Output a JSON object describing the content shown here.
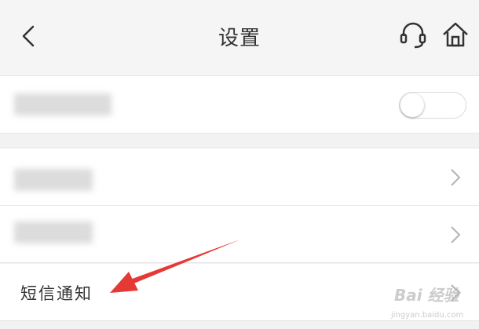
{
  "header": {
    "title": "设置",
    "back_icon": "chevron-left-icon",
    "customer_service_icon": "headset-icon",
    "home_icon": "home-icon"
  },
  "rows": [
    {
      "type": "toggle",
      "label_visible": false,
      "toggle_on": false
    },
    {
      "type": "link",
      "label_visible": false
    },
    {
      "type": "link",
      "label_visible": false
    },
    {
      "type": "link",
      "label": "短信通知"
    }
  ],
  "annotation": {
    "arrow_color": "#e53935"
  },
  "watermark": {
    "text": "Bai 经验",
    "sub": "jingyan.baidu.com"
  },
  "colors": {
    "background": "#f2f2f2",
    "header": "#f5f5f5",
    "row": "#ffffff"
  }
}
